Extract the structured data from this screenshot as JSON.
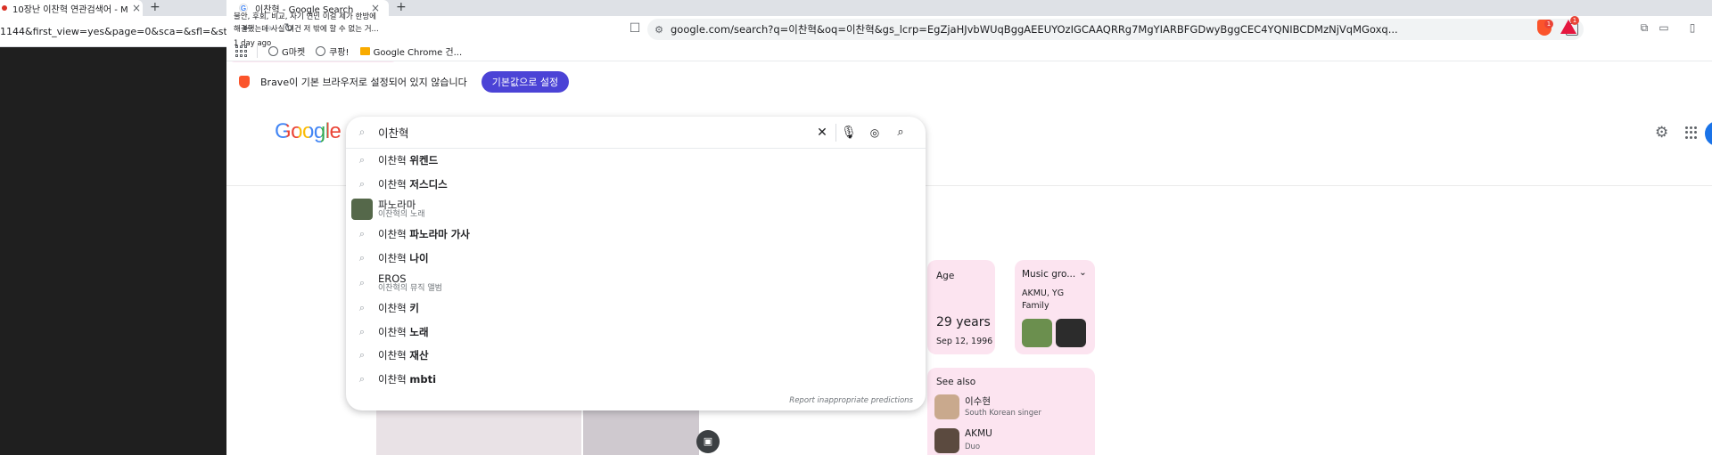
{
  "left_window": {
    "tab_title": "10장난 이찬혁 연관검색어 - M",
    "url_fragment": "1144&first_view=yes&page=0&sca=&sfl=&stx=&spt="
  },
  "browser": {
    "tab_title": "이찬혁 - Google Search",
    "url": "google.com/search?q=이찬혁&oq=이찬혁&gs_lcrp=EgZjaHJvbWUqBggAEEUYOzIGCAAQRRg7MgYIARBFGDwyBggCEC4YQNIBCDMzNjVqMGoxq...",
    "shield_badge": "1",
    "rewards_badge": "1",
    "bookmarks": [
      {
        "label": "G마켓",
        "icon": "globe-icon"
      },
      {
        "label": "쿠팡!",
        "icon": "globe-icon"
      },
      {
        "label": "Google Chrome 건...",
        "icon": "folder-icon"
      }
    ]
  },
  "brave_banner": {
    "text": "Brave이 기본 브라우저로 설정되어 있지 않습니다",
    "button": "기본값으로 설정"
  },
  "search": {
    "logo": "Google",
    "query": "이찬혁",
    "report": "Report inappropriate predictions",
    "suggestions": [
      {
        "prefix": "이찬혁 ",
        "bold": "위켄드"
      },
      {
        "prefix": "이찬혁 ",
        "bold": "저스디스"
      },
      {
        "title": "파노라마",
        "subtitle": "이찬혁의 노래",
        "rich": true
      },
      {
        "prefix": "이찬혁 ",
        "bold": "파노라마 가사"
      },
      {
        "prefix": "이찬혁 ",
        "bold": "나이"
      },
      {
        "title": "EROS",
        "subtitle": "이찬혁의 뮤직 앨범",
        "rich": true
      },
      {
        "prefix": "이찬혁 ",
        "bold": "키"
      },
      {
        "prefix": "이찬혁 ",
        "bold": "노래"
      },
      {
        "prefix": "이찬혁 ",
        "bold": "재산"
      },
      {
        "prefix": "이찬혁 ",
        "bold": "mbti"
      }
    ]
  },
  "knowledge": {
    "age_label": "Age",
    "age_value": "29 years",
    "birth_date": "Sep 12, 1996",
    "music_label": "Music gro...",
    "music_value_1": "AKMU, YG",
    "music_value_2": "Family",
    "see_also": "See also",
    "people": [
      {
        "name": "이수현",
        "desc": "South Korean singer"
      },
      {
        "name": "AKMU",
        "desc": "Duo"
      }
    ],
    "news_text_1": "불안, 후회, 비교, 자기 연민 이걸 제가 한방에",
    "news_text_2": "해결했는데 사실 이건 저 밖에 할 수 없는 거...",
    "news_time": "1 day ago"
  }
}
